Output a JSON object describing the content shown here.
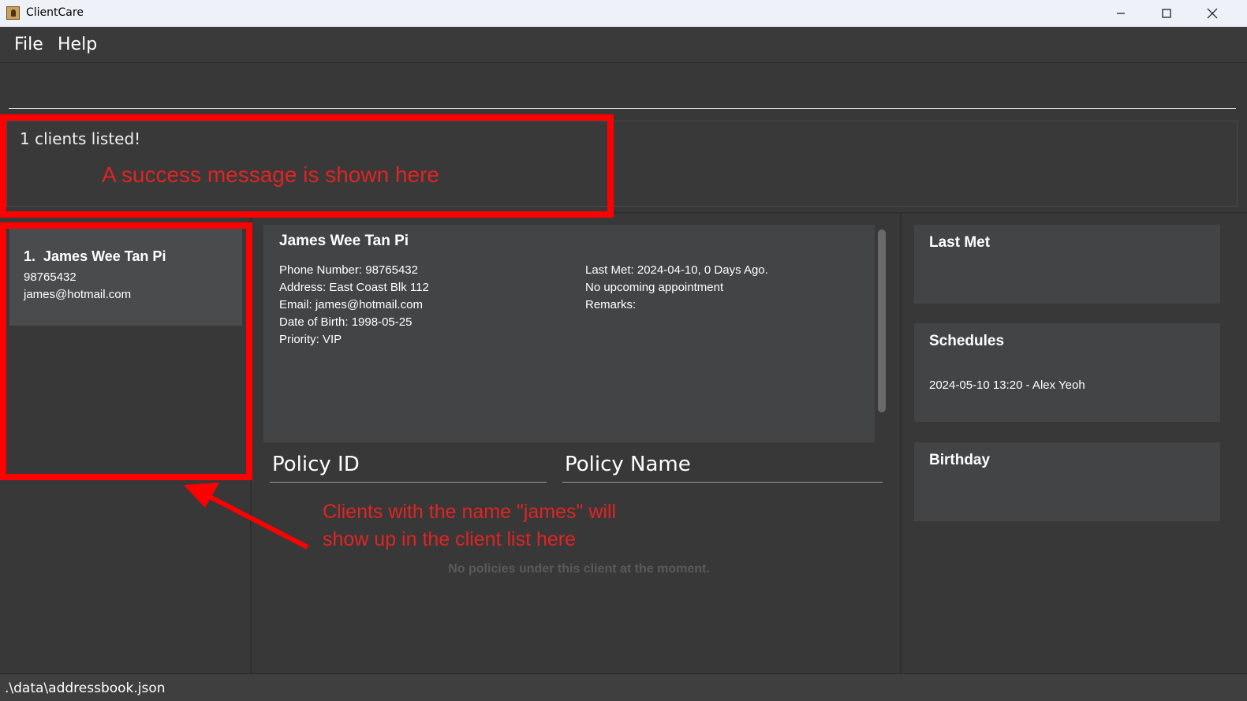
{
  "window": {
    "title": "ClientCare",
    "icon": "app-icon",
    "controls": [
      "minimize-icon",
      "maximize-icon",
      "close-icon"
    ]
  },
  "menu": {
    "items": [
      {
        "label": "File"
      },
      {
        "label": "Help"
      }
    ]
  },
  "command_box": {
    "value": "",
    "placeholder": ""
  },
  "result_display": {
    "message": "1 clients listed!"
  },
  "client_list": {
    "items": [
      {
        "index": "1.",
        "name": "James Wee Tan Pi",
        "phone": "98765432",
        "email": "james@hotmail.com"
      }
    ]
  },
  "client_detail": {
    "name": "James Wee Tan Pi",
    "left": [
      "Phone Number: 98765432",
      "Address: East Coast Blk 112",
      "Email: james@hotmail.com",
      "Date of Birth: 1998-05-25",
      "Priority: VIP"
    ],
    "right": [
      "Last Met: 2024-04-10, 0 Days Ago.",
      "No upcoming appointment",
      "Remarks:"
    ]
  },
  "policy_table": {
    "columns": [
      "Policy ID",
      "Policy Name"
    ],
    "empty_message": "No policies under this client at the moment."
  },
  "side_panels": {
    "last_met": {
      "title": "Last Met"
    },
    "schedules": {
      "title": "Schedules",
      "entries": [
        "2024-05-10 13:20 - Alex Yeoh"
      ]
    },
    "birthday": {
      "title": "Birthday"
    }
  },
  "annotations": {
    "success_note": "A success message is shown here",
    "list_note_line1": "Clients with the name \"james\" will",
    "list_note_line2": "show up in the client list here",
    "color": "#ff0000"
  },
  "status_bar": {
    "path": ".\\data\\addressbook.json"
  }
}
